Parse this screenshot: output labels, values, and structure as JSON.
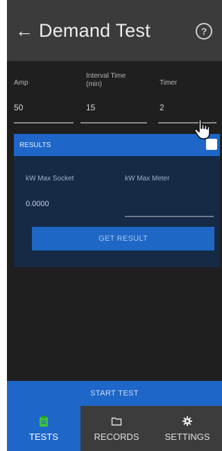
{
  "appbar": {
    "title": "Demand Test",
    "back_icon": "←",
    "help_icon": "?"
  },
  "fields": [
    {
      "label": "Amp",
      "value": "50"
    },
    {
      "label": "Interval Time (min)",
      "value": "15"
    },
    {
      "label": "Timer",
      "value": "2"
    }
  ],
  "results": {
    "title": "RESULTS",
    "kw_max_socket_label": "kW Max Socket",
    "kw_max_meter_label": "kW Max Meter",
    "kw_max_socket_value": "0.0000",
    "kw_max_meter_value": "",
    "get_result_label": "GET RESULT"
  },
  "start_test_label": "START TEST",
  "nav": {
    "tests": "TESTS",
    "records": "RECORDS",
    "settings": "SETTINGS",
    "active": "TESTS"
  },
  "colors": {
    "accent": "#1e66c8",
    "background": "#1f1f1f",
    "appbar": "#3b3b3b",
    "tests_icon": "#3cc43c"
  }
}
